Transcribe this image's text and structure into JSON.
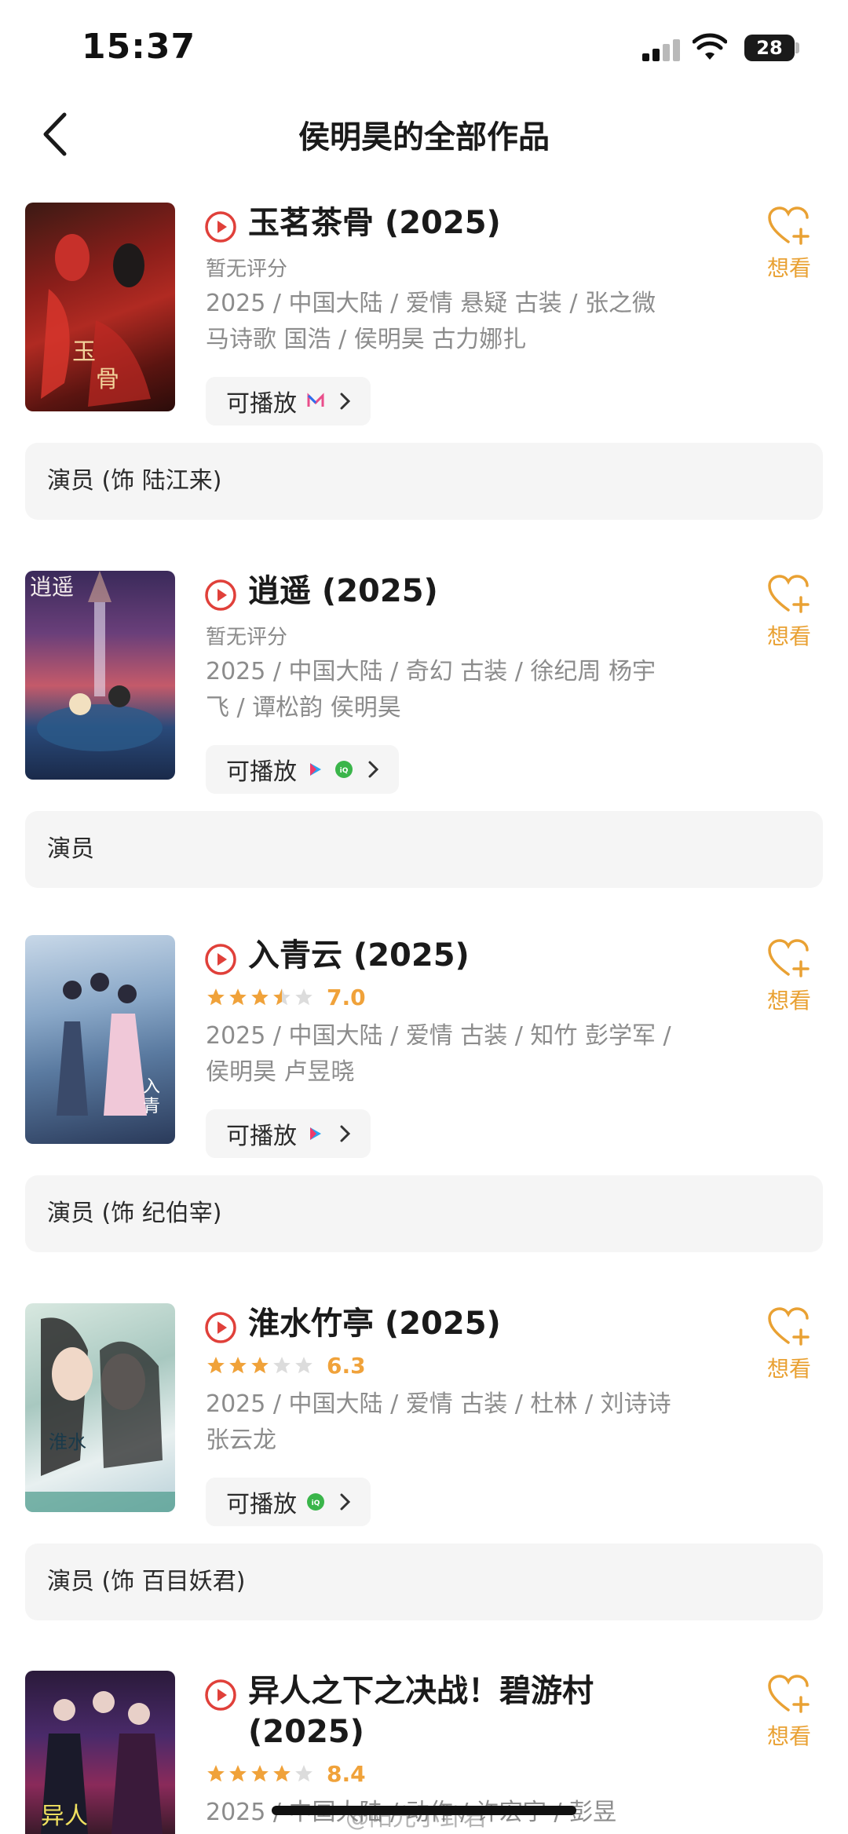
{
  "status_bar": {
    "time": "15:37",
    "battery": "28"
  },
  "nav": {
    "title": "侯明昊的全部作品"
  },
  "colors": {
    "accent": "#e9a133",
    "play_red": "#e0403a",
    "star": "#f0a23a",
    "meta": "#8c8c8c"
  },
  "works": [
    {
      "title": "玉茗茶骨 (2025)",
      "rating_text": "暂无评分",
      "meta": [
        "2025 / 中国大陆 / 爱情 悬疑 古装 / 张之微",
        "马诗歌 国浩 / 侯明昊 古力娜扎"
      ],
      "play_label": "可播放",
      "platforms": [
        "mgtv-icon"
      ],
      "want_label": "想看",
      "role": "演员 (饰 陆江来)"
    },
    {
      "title": "逍遥 (2025)",
      "rating_text": "暂无评分",
      "meta": [
        "2025 / 中国大陆 / 奇幻 古装 / 徐纪周 杨宇",
        "飞 / 谭松韵 侯明昊"
      ],
      "play_label": "可播放",
      "platforms": [
        "youku-icon",
        "iqiyi-icon"
      ],
      "want_label": "想看",
      "role": "演员"
    },
    {
      "title": "入青云 (2025)",
      "stars": 3.5,
      "score": "7.0",
      "meta": [
        "2025 / 中国大陆 / 爱情 古装 / 知竹 彭学军 /",
        "侯明昊 卢昱晓"
      ],
      "play_label": "可播放",
      "platforms": [
        "youku-icon"
      ],
      "want_label": "想看",
      "role": "演员 (饰 纪伯宰)"
    },
    {
      "title": "淮水竹亭 (2025)",
      "stars": 3,
      "score": "6.3",
      "meta": [
        "2025 / 中国大陆 / 爱情 古装 / 杜林 / 刘诗诗",
        "张云龙"
      ],
      "play_label": "可播放",
      "platforms": [
        "iqiyi-icon"
      ],
      "want_label": "想看",
      "role": "演员 (饰 百目妖君)"
    },
    {
      "title_line1": "异人之下之决战！碧游村",
      "title_line2": "(2025)",
      "stars": 4,
      "score": "8.4",
      "meta": [
        "2025 / 中国大陆 / 动作 / 许宏宇 / 彭昱"
      ],
      "want_label": "想看"
    }
  ],
  "watermark": "@阳光小卦君"
}
